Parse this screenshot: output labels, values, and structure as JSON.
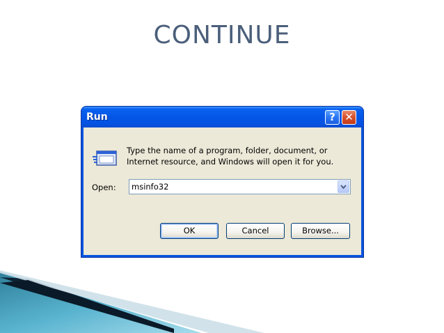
{
  "slide": {
    "title": "CONTINUE"
  },
  "dialog": {
    "title": "Run",
    "help_label": "?",
    "close_label": "✕",
    "message_line1": "Type the name of a program, folder, document, or",
    "message_line2": "Internet resource, and Windows will open it for you.",
    "open_label": "Open:",
    "open_value": "msinfo32",
    "ok_label": "OK",
    "cancel_label": "Cancel",
    "browse_label": "Browse..."
  },
  "icons": {
    "run": "run-program-icon",
    "combo_arrow": "chevron-down-icon",
    "help": "help-icon",
    "close": "close-icon"
  },
  "colors": {
    "title_text": "#4b5f7a",
    "titlebar_blue": "#0554e4",
    "close_red": "#d6502c",
    "dialog_face": "#ece9d8"
  }
}
